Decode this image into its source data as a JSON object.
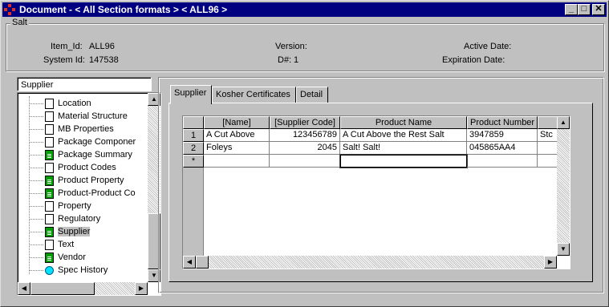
{
  "window": {
    "title": "Document - < All Section formats > < ALL96 >"
  },
  "salt": {
    "group_label": "Salt",
    "item_id_label": "Item_Id:",
    "item_id_value": "ALL96",
    "system_id_label": "System Id:",
    "system_id_value": "147538",
    "version_label": "Version:",
    "dnum_label": "D#:",
    "dnum_value": "1",
    "active_date_label": "Active Date:",
    "expiration_date_label": "Expiration Date:"
  },
  "left_panel": {
    "selected_section": "Supplier",
    "tree_items": [
      {
        "label": "Location",
        "icon": "document-icon"
      },
      {
        "label": "Material Structure",
        "icon": "document-icon"
      },
      {
        "label": "MB Properties",
        "icon": "document-icon"
      },
      {
        "label": "Package Componer",
        "icon": "document-icon"
      },
      {
        "label": "Package Summary",
        "icon": "document-filled-icon"
      },
      {
        "label": "Product Codes",
        "icon": "document-icon"
      },
      {
        "label": "Product Property",
        "icon": "document-filled-icon"
      },
      {
        "label": "Product-Product Co",
        "icon": "document-filled-icon"
      },
      {
        "label": "Property",
        "icon": "document-icon"
      },
      {
        "label": "Regulatory",
        "icon": "document-icon"
      },
      {
        "label": "Supplier",
        "icon": "document-filled-icon"
      },
      {
        "label": "Text",
        "icon": "document-icon"
      },
      {
        "label": "Vendor",
        "icon": "document-filled-icon"
      },
      {
        "label": "Spec History",
        "icon": "circle-icon"
      }
    ]
  },
  "tabs": [
    {
      "label": "Supplier"
    },
    {
      "label": "Kosher Certificates"
    },
    {
      "label": "Detail"
    }
  ],
  "grid": {
    "columns": [
      "[Name]",
      "[Supplier Code]",
      "Product Name",
      "Product Number",
      ""
    ],
    "rows": [
      {
        "num": "1",
        "cells": [
          "A Cut Above",
          "123456789",
          "A Cut Above the Rest Salt",
          "3947859",
          "Stc"
        ]
      },
      {
        "num": "2",
        "cells": [
          "Foleys",
          "2045",
          "Salt! Salt!",
          "045865AA4",
          ""
        ]
      }
    ],
    "new_row_marker": "*"
  },
  "colors": {
    "title_bar": "#000080",
    "face": "#c0c0c0",
    "doc_filled": "#00a000",
    "history_circle": "#00e0ff"
  }
}
